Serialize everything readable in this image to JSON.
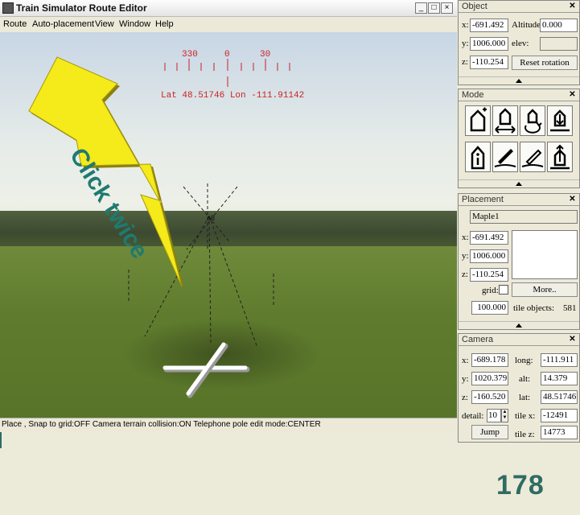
{
  "window": {
    "title": "Train Simulator Route Editor",
    "controls": [
      "_",
      "□",
      "×"
    ]
  },
  "menu": [
    "Route",
    "Auto-placement",
    "View",
    "Window",
    "Help"
  ],
  "viewport": {
    "compass_ticks": [
      "330",
      "0",
      "30"
    ],
    "coords": "Lat 48.51746 Lon -111.91142",
    "marker_label": "a8",
    "annotation": "Click twice"
  },
  "status_bar": "Place , Snap to grid:OFF Camera terrain collision:ON Telephone pole edit mode:CENTER",
  "object_panel": {
    "title": "Object",
    "x_label": "x:",
    "x": "-691.492",
    "y_label": "y:",
    "y": "1006.000",
    "z_label": "z:",
    "z": "-110.254",
    "altitude_label": "Altitude",
    "altitude": "0.000",
    "elev_label": "elev:",
    "elev": "",
    "reset_button": "Reset rotation"
  },
  "mode_panel": {
    "title": "Mode",
    "icons": [
      "place-mode-icon",
      "move-mode-icon",
      "rotate-mode-icon",
      "lower-mode-icon",
      "info-mode-icon",
      "paint-terrain-icon",
      "pick-terrain-icon",
      "raise-mode-icon"
    ]
  },
  "placement_panel": {
    "title": "Placement",
    "object_name": "Maple1",
    "x_label": "x:",
    "x": "-691.492",
    "y_label": "y:",
    "y": "1006.000",
    "z_label": "z:",
    "z": "-110.254",
    "grid_label": "grid:",
    "more_button": "More..",
    "grid_value": "100.000",
    "tile_objects_label": "tile objects:",
    "tile_objects": "581"
  },
  "camera_panel": {
    "title": "Camera",
    "x_label": "x:",
    "x": "-689.178",
    "y_label": "y:",
    "y": "1020.379",
    "z_label": "z:",
    "z": "-160.520",
    "detail_label": "detail:",
    "detail": "10",
    "long_label": "long:",
    "long": "-111.911",
    "alt_label": "alt:",
    "alt": "14.379",
    "lat_label": "lat:",
    "lat": "48.51746",
    "tilex_label": "tile x:",
    "tilex": "-12491",
    "tilez_label": "tile z:",
    "tilez": "14773",
    "jump_button": "Jump"
  },
  "page_number": "178",
  "colors": {
    "compass_red": "#cc2222",
    "arrow_yellow": "#f5ea1a",
    "annotation_teal": "#1f7a70",
    "page_number_teal": "#2f6b63"
  }
}
